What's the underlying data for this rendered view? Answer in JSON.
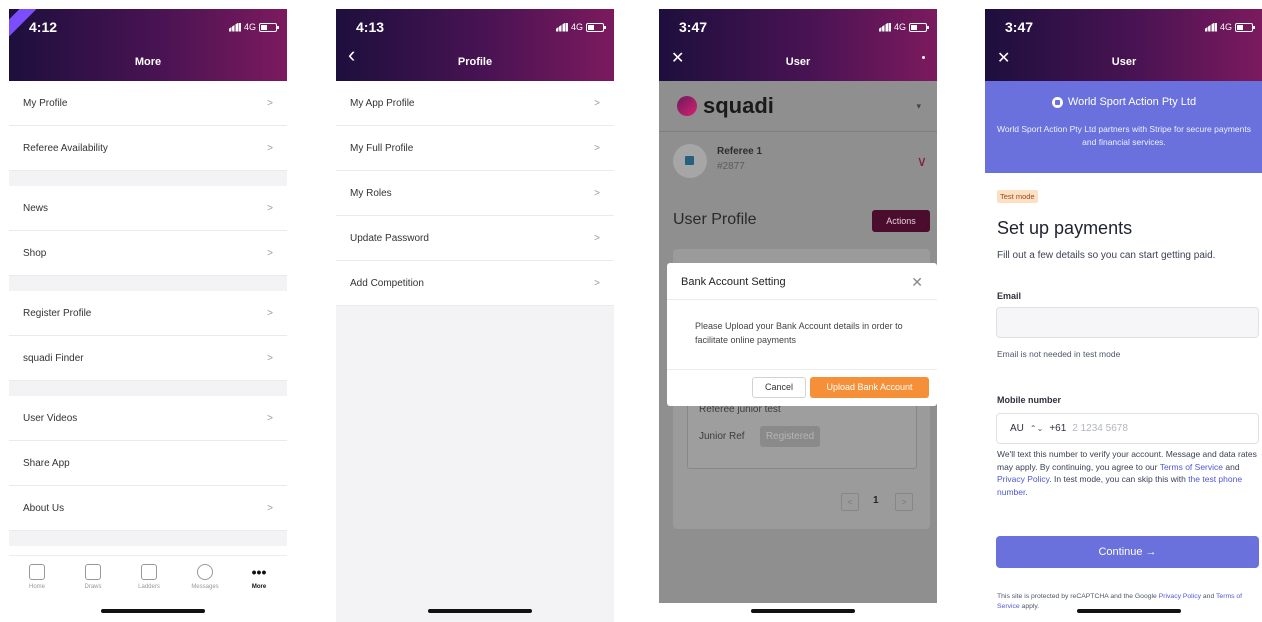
{
  "screen1": {
    "status_time": "4:12",
    "network": "4G",
    "title": "More",
    "groups": [
      [
        {
          "label": "My Profile",
          "chevron": ">"
        },
        {
          "label": "Referee Availability",
          "chevron": ">"
        }
      ],
      [
        {
          "label": "News",
          "chevron": ">"
        },
        {
          "label": "Shop",
          "chevron": ">"
        }
      ],
      [
        {
          "label": "Register Profile",
          "chevron": ">"
        },
        {
          "label": "squadi Finder",
          "chevron": ">"
        }
      ],
      [
        {
          "label": "User Videos",
          "chevron": ">"
        },
        {
          "label": "Share App",
          "chevron": ""
        },
        {
          "label": "About Us",
          "chevron": ">"
        }
      ]
    ],
    "tabs": [
      {
        "label": "Home",
        "icon": "home-icon"
      },
      {
        "label": "Draws",
        "icon": "draws-icon"
      },
      {
        "label": "Ladders",
        "icon": "ladders-icon"
      },
      {
        "label": "Messages",
        "icon": "messages-icon"
      },
      {
        "label": "More",
        "icon": "more-icon",
        "glyph": "•••",
        "active": true
      }
    ]
  },
  "screen2": {
    "status_time": "4:13",
    "network": "4G",
    "title": "Profile",
    "back_glyph": "‹",
    "items": [
      {
        "label": "My App Profile",
        "chevron": ">"
      },
      {
        "label": "My Full Profile",
        "chevron": ">"
      },
      {
        "label": "My Roles",
        "chevron": ">"
      },
      {
        "label": "Update Password",
        "chevron": ">"
      },
      {
        "label": "Add Competition",
        "chevron": ">"
      }
    ]
  },
  "screen3": {
    "status_time": "3:47",
    "network": "4G",
    "title": "User",
    "close_glyph": "✕",
    "logo_text": "squadi",
    "dropdown_glyph": "▾",
    "referee_name": "Referee 1",
    "referee_id": "#2877",
    "referee_caret": "∨",
    "section_title": "User Profile",
    "actions_label": "Actions",
    "card_title": "Referee junior test",
    "role_label": "Junior Ref",
    "role_status": "Registered",
    "pagination": {
      "prev": "<",
      "page": "1",
      "next": ">"
    },
    "modal": {
      "title": "Bank Account Setting",
      "close_glyph": "✕",
      "body": "Please Upload your Bank Account details in order to facilitate online payments",
      "cancel_label": "Cancel",
      "upload_label": "Upload Bank Account"
    }
  },
  "screen4": {
    "status_time": "3:47",
    "network": "4G",
    "title": "User",
    "close_glyph": "✕",
    "banner_name": "World Sport Action Pty Ltd",
    "banner_desc": "World Sport Action Pty Ltd partners with Stripe for secure payments and financial services.",
    "test_mode": "Test mode",
    "heading": "Set up payments",
    "subheading": "Fill out a few details so you can start getting paid.",
    "email_label": "Email",
    "email_value": "",
    "email_helper": "Email is not needed in test mode",
    "mobile_label": "Mobile number",
    "country": "AU",
    "country_toggle": "⌃⌄",
    "dial_code": "+61",
    "phone_placeholder": "2 1234 5678",
    "legal_1": "We'll text this number to verify your account. Message and data rates may apply. By continuing, you agree to our ",
    "terms_link": "Terms of Service",
    "legal_and": " and ",
    "privacy_link": "Privacy Policy",
    "legal_2": ". In test mode, you can skip this with ",
    "test_phone_link": "the test phone number",
    "legal_end": ".",
    "continue_label": "Continue →",
    "recaptcha_1": "This site is protected by reCAPTCHA and the Google ",
    "recaptcha_privacy": "Privacy Policy",
    "recaptcha_and": " and ",
    "recaptcha_terms": "Terms of Service",
    "recaptcha_end": " apply."
  },
  "colors": {
    "header_gradient": [
      "#1d0f3d",
      "#4a1353",
      "#7c1a5e"
    ],
    "stripe_accent": "#6a71dc",
    "upload_button": "#f59039",
    "actions_button": "#4a0d2e"
  }
}
